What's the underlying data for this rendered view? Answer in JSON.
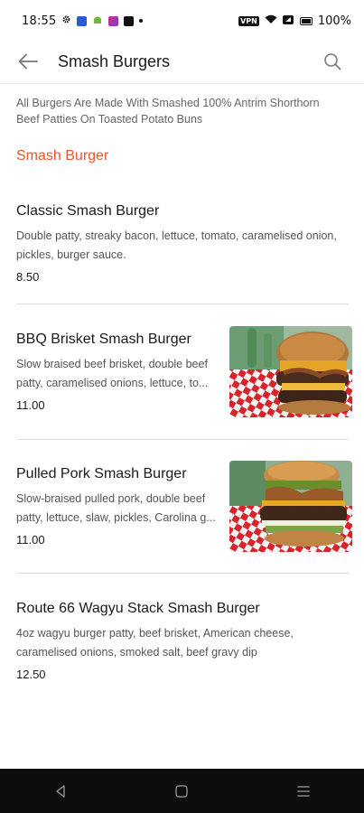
{
  "status_bar": {
    "time": "18:55",
    "battery": "100%",
    "vpn": "VPN"
  },
  "header": {
    "title": "Smash Burgers"
  },
  "intro_text": "All Burgers Are Made With Smashed 100% Antrim Shorthorn Beef Patties On Toasted Potato Buns",
  "section": {
    "title": "Smash Burger"
  },
  "items": [
    {
      "name": "Classic Smash Burger",
      "description": "Double patty, streaky bacon, lettuce, tomato, caramelised onion, pickles, burger sauce.",
      "price": "8.50"
    },
    {
      "name": "BBQ Brisket Smash Burger",
      "description": "Slow braised beef brisket, double beef patty, caramelised onions, lettuce, to...",
      "price": "11.00"
    },
    {
      "name": "Pulled Pork Smash Burger",
      "description": "Slow-braised pulled pork, double beef patty, lettuce, slaw, pickles, Carolina g...",
      "price": "11.00"
    },
    {
      "name": "Route 66 Wagyu Stack Smash Burger",
      "description": "4oz wagyu burger patty, beef brisket, American cheese, caramelised  onions, smoked salt, beef gravy dip",
      "price": "12.50"
    }
  ],
  "colors": {
    "accent": "#e8552f",
    "text": "#1a1a1a",
    "secondary_text": "#555555",
    "nav_bar": "#0d0d0d"
  }
}
